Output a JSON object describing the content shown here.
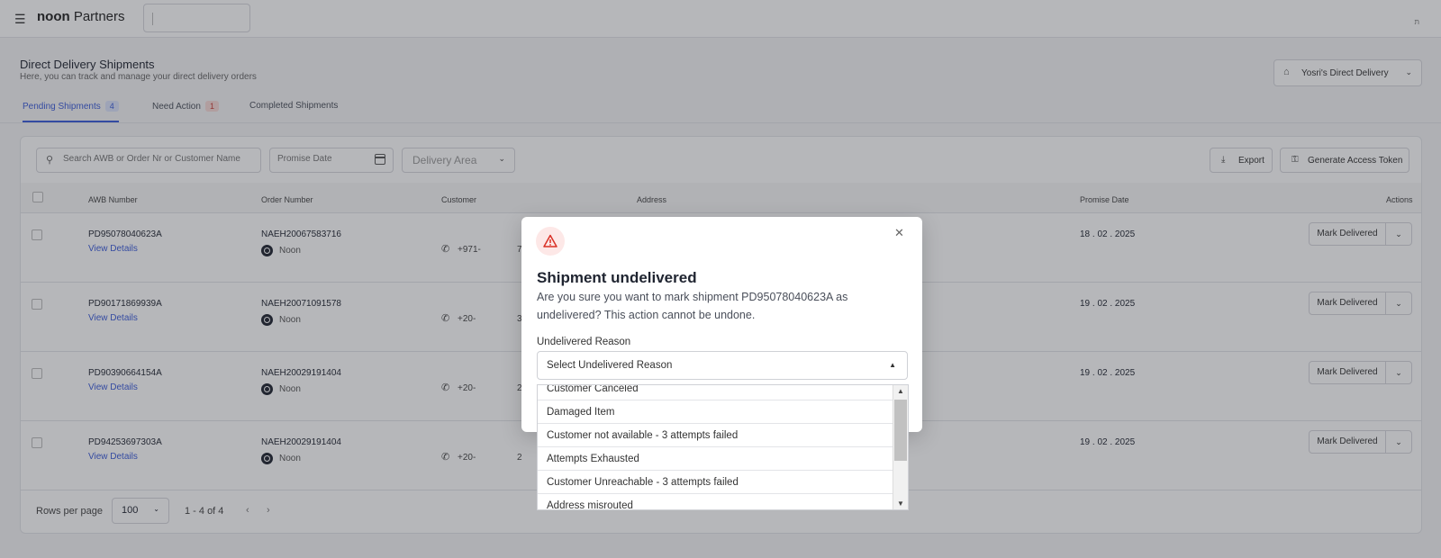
{
  "topbar": {
    "menu_icon": "hamburger-icon",
    "brand_bold": "noon",
    "brand_rest": " Partners",
    "user_initials": "ת"
  },
  "page": {
    "title": "Direct Delivery Shipments",
    "subtitle": "Here, you can track and manage your direct delivery orders",
    "delivery_select": "Yosri's Direct Delivery"
  },
  "tabs": [
    {
      "label": "Pending Shipments",
      "count": "4"
    },
    {
      "label": "Need Action",
      "count": "1"
    },
    {
      "label": "Completed Shipments"
    }
  ],
  "filters": {
    "search_placeholder": "Search AWB or Order Nr or Customer Name",
    "promise_placeholder": "Promise Date",
    "area_placeholder": "Delivery Area",
    "export_label": "Export",
    "token_label": "Generate Access Token"
  },
  "table": {
    "columns": [
      "AWB Number",
      "Order Number",
      "Customer",
      "Address",
      "Promise Date",
      "Actions"
    ],
    "rows": [
      {
        "awb": "PD95078040623A",
        "details": "View Details",
        "order": "NAEH20067583716",
        "brand": "Noon",
        "phone": "+971-",
        "addr": "7",
        "date": "18 . 02 . 2025",
        "action": "Mark Delivered"
      },
      {
        "awb": "PD90171869939A",
        "details": "View Details",
        "order": "NAEH20071091578",
        "brand": "Noon",
        "phone": "+20-",
        "addr": "3",
        "date": "19 . 02 . 2025",
        "action": "Mark Delivered"
      },
      {
        "awb": "PD90390664154A",
        "details": "View Details",
        "order": "NAEH20029191404",
        "brand": "Noon",
        "phone": "+20-",
        "addr": "2",
        "date": "19 . 02 . 2025",
        "action": "Mark Delivered"
      },
      {
        "awb": "PD94253697303A",
        "details": "View Details",
        "order": "NAEH20029191404",
        "brand": "Noon",
        "phone": "+20-",
        "addr": "2",
        "date": "19 . 02 . 2025",
        "action": "Mark Delivered"
      }
    ]
  },
  "pagination": {
    "rows_label": "Rows per page",
    "rows_value": "100",
    "range": "1 - 4 of 4"
  },
  "modal": {
    "title": "Shipment undelivered",
    "body": "Are you sure you want to mark shipment PD95078040623A as undelivered? This action cannot be undone.",
    "reason_label": "Undelivered Reason",
    "reason_placeholder": "Select Undelivered Reason",
    "options": [
      "Customer Canceled",
      "Damaged Item",
      "Customer not available - 3 attempts failed",
      "Attempts Exhausted",
      "Customer Unreachable - 3 attempts failed",
      "Address misrouted"
    ]
  },
  "colors": {
    "accent": "#3b5bd9",
    "danger": "#c94038"
  }
}
